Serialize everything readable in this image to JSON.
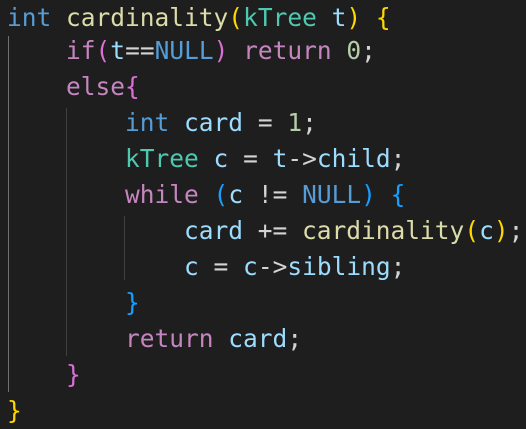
{
  "code_lines": [
    [
      {
        "text": "int",
        "cls": "tok-type"
      },
      {
        "text": " ",
        "cls": "tok-op"
      },
      {
        "text": "cardinality",
        "cls": "tok-fn"
      },
      {
        "text": "(",
        "cls": "b1"
      },
      {
        "text": "kTree",
        "cls": "tok-typename"
      },
      {
        "text": " ",
        "cls": "tok-op"
      },
      {
        "text": "t",
        "cls": "tok-var"
      },
      {
        "text": ")",
        "cls": "b1"
      },
      {
        "text": " ",
        "cls": "tok-op"
      },
      {
        "text": "{",
        "cls": "b1"
      }
    ],
    [
      {
        "text": "    ",
        "cls": "tok-op"
      },
      {
        "text": "if",
        "cls": "tok-ctrl"
      },
      {
        "text": "(",
        "cls": "b2"
      },
      {
        "text": "t",
        "cls": "tok-var"
      },
      {
        "text": "==",
        "cls": "tok-op"
      },
      {
        "text": "NULL",
        "cls": "tok-const"
      },
      {
        "text": ")",
        "cls": "b2"
      },
      {
        "text": " ",
        "cls": "tok-op"
      },
      {
        "text": "return",
        "cls": "tok-ctrl"
      },
      {
        "text": " ",
        "cls": "tok-op"
      },
      {
        "text": "0",
        "cls": "tok-num"
      },
      {
        "text": ";",
        "cls": "tok-op"
      }
    ],
    [
      {
        "text": "    ",
        "cls": "tok-op"
      },
      {
        "text": "else",
        "cls": "tok-ctrl"
      },
      {
        "text": "{",
        "cls": "b2"
      }
    ],
    [
      {
        "text": "        ",
        "cls": "tok-op"
      },
      {
        "text": "int",
        "cls": "tok-type"
      },
      {
        "text": " ",
        "cls": "tok-op"
      },
      {
        "text": "card",
        "cls": "tok-var"
      },
      {
        "text": " = ",
        "cls": "tok-op"
      },
      {
        "text": "1",
        "cls": "tok-num"
      },
      {
        "text": ";",
        "cls": "tok-op"
      }
    ],
    [
      {
        "text": "        ",
        "cls": "tok-op"
      },
      {
        "text": "kTree",
        "cls": "tok-typename"
      },
      {
        "text": " ",
        "cls": "tok-op"
      },
      {
        "text": "c",
        "cls": "tok-var"
      },
      {
        "text": " = ",
        "cls": "tok-op"
      },
      {
        "text": "t",
        "cls": "tok-var"
      },
      {
        "text": "->",
        "cls": "tok-op"
      },
      {
        "text": "child",
        "cls": "tok-var"
      },
      {
        "text": ";",
        "cls": "tok-op"
      }
    ],
    [
      {
        "text": "        ",
        "cls": "tok-op"
      },
      {
        "text": "while",
        "cls": "tok-ctrl"
      },
      {
        "text": " ",
        "cls": "tok-op"
      },
      {
        "text": "(",
        "cls": "b3"
      },
      {
        "text": "c",
        "cls": "tok-var"
      },
      {
        "text": " != ",
        "cls": "tok-op"
      },
      {
        "text": "NULL",
        "cls": "tok-const"
      },
      {
        "text": ")",
        "cls": "b3"
      },
      {
        "text": " ",
        "cls": "tok-op"
      },
      {
        "text": "{",
        "cls": "b3"
      }
    ],
    [
      {
        "text": "            ",
        "cls": "tok-op"
      },
      {
        "text": "card",
        "cls": "tok-var"
      },
      {
        "text": " += ",
        "cls": "tok-op"
      },
      {
        "text": "cardinality",
        "cls": "tok-fn"
      },
      {
        "text": "(",
        "cls": "b1"
      },
      {
        "text": "c",
        "cls": "tok-var"
      },
      {
        "text": ")",
        "cls": "b1"
      },
      {
        "text": ";",
        "cls": "tok-op"
      }
    ],
    [
      {
        "text": "            ",
        "cls": "tok-op"
      },
      {
        "text": "c",
        "cls": "tok-var"
      },
      {
        "text": " = ",
        "cls": "tok-op"
      },
      {
        "text": "c",
        "cls": "tok-var"
      },
      {
        "text": "->",
        "cls": "tok-op"
      },
      {
        "text": "sibling",
        "cls": "tok-var"
      },
      {
        "text": ";",
        "cls": "tok-op"
      }
    ],
    [
      {
        "text": "        ",
        "cls": "tok-op"
      },
      {
        "text": "}",
        "cls": "b3"
      }
    ],
    [
      {
        "text": "        ",
        "cls": "tok-op"
      },
      {
        "text": "return",
        "cls": "tok-ctrl"
      },
      {
        "text": " ",
        "cls": "tok-op"
      },
      {
        "text": "card",
        "cls": "tok-var"
      },
      {
        "text": ";",
        "cls": "tok-op"
      }
    ],
    [
      {
        "text": "    ",
        "cls": "tok-op"
      },
      {
        "text": "}",
        "cls": "b2"
      }
    ],
    [
      {
        "text": "}",
        "cls": "b1"
      }
    ]
  ],
  "theme": {
    "background": "#1e1e1e",
    "keyword_type": "#569cd6",
    "function": "#dcdcaa",
    "type_name": "#4ec9b0",
    "variable": "#9cdcfe",
    "control": "#c586c0",
    "number": "#b5cea8",
    "bracket_level_1": "#ffd700",
    "bracket_level_2": "#da70d6",
    "bracket_level_3": "#179fff"
  }
}
